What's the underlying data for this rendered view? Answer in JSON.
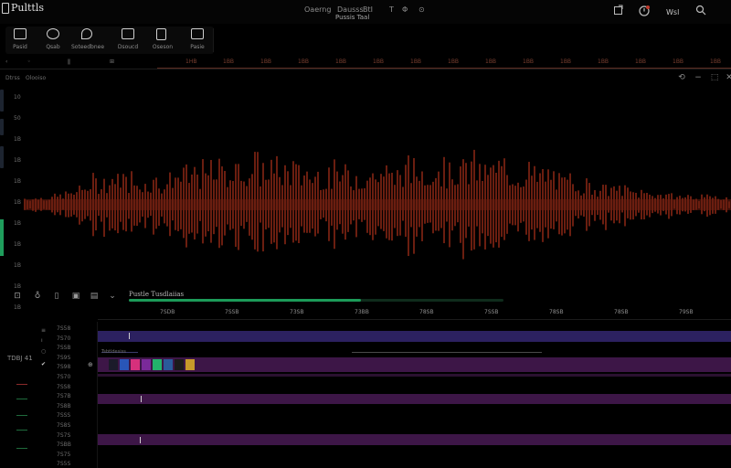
{
  "app": {
    "title": "Pulttls"
  },
  "topbar": {
    "menu": [
      "Oaerng",
      "Dausss",
      "BtI",
      "T",
      "Φ",
      "⊙"
    ],
    "project_name": "Pussis Taal",
    "right_label": "Wsl"
  },
  "toolbar": {
    "tools": [
      {
        "label": "Pasid",
        "icon": "book-icon"
      },
      {
        "label": "Qsab",
        "icon": "clock-icon"
      },
      {
        "label": "Soteedbnee",
        "icon": "search-icon"
      },
      {
        "label": "Dsoucd",
        "icon": "folder-icon"
      },
      {
        "label": "Oseson",
        "icon": "document-icon"
      },
      {
        "label": "Pasie",
        "icon": "screen-icon"
      }
    ]
  },
  "ruler_top": {
    "ticks": [
      "1HB",
      "1BB",
      "1BB",
      "1BB",
      "1BB",
      "1BB",
      "1BB",
      "1BB",
      "1BB",
      "1BB",
      "1BB",
      "1BB",
      "1BB",
      "1BB",
      "1BB"
    ]
  },
  "sub_labels": [
    "Dtrss",
    "Olooiso"
  ],
  "db_scale": [
    "10",
    "50",
    "1B",
    "1B",
    "1B",
    "1B",
    "1B",
    "1B",
    "1B",
    "1B",
    "1B"
  ],
  "timeline": {
    "title": "Pustle Tusdlaiias",
    "progress": 0.62,
    "ruler_ticks": [
      "7SDB",
      "7SSB",
      "73SB",
      "73BB",
      "78SB",
      "7SSB",
      "78SB",
      "78SB",
      "79SB"
    ]
  },
  "tracks": {
    "side_label": "TDBJ 41",
    "time_labels": [
      "7S58",
      "7S70",
      "7SSB",
      "7S9S",
      "7S98",
      "7S70",
      "7SS8",
      "7S7B",
      "7S8B",
      "7SSS",
      "7S8S",
      "7S7S",
      "7SBB",
      "7S75",
      "7S5S"
    ],
    "clip_label": "Tsbtldesiss"
  },
  "colors": {
    "waveform": "#6b1e10",
    "progress": "#1c9b59",
    "lane_blue": "#2c2160",
    "lane_purple": "#3d1647",
    "ruler_accent": "#5a2a1f"
  }
}
